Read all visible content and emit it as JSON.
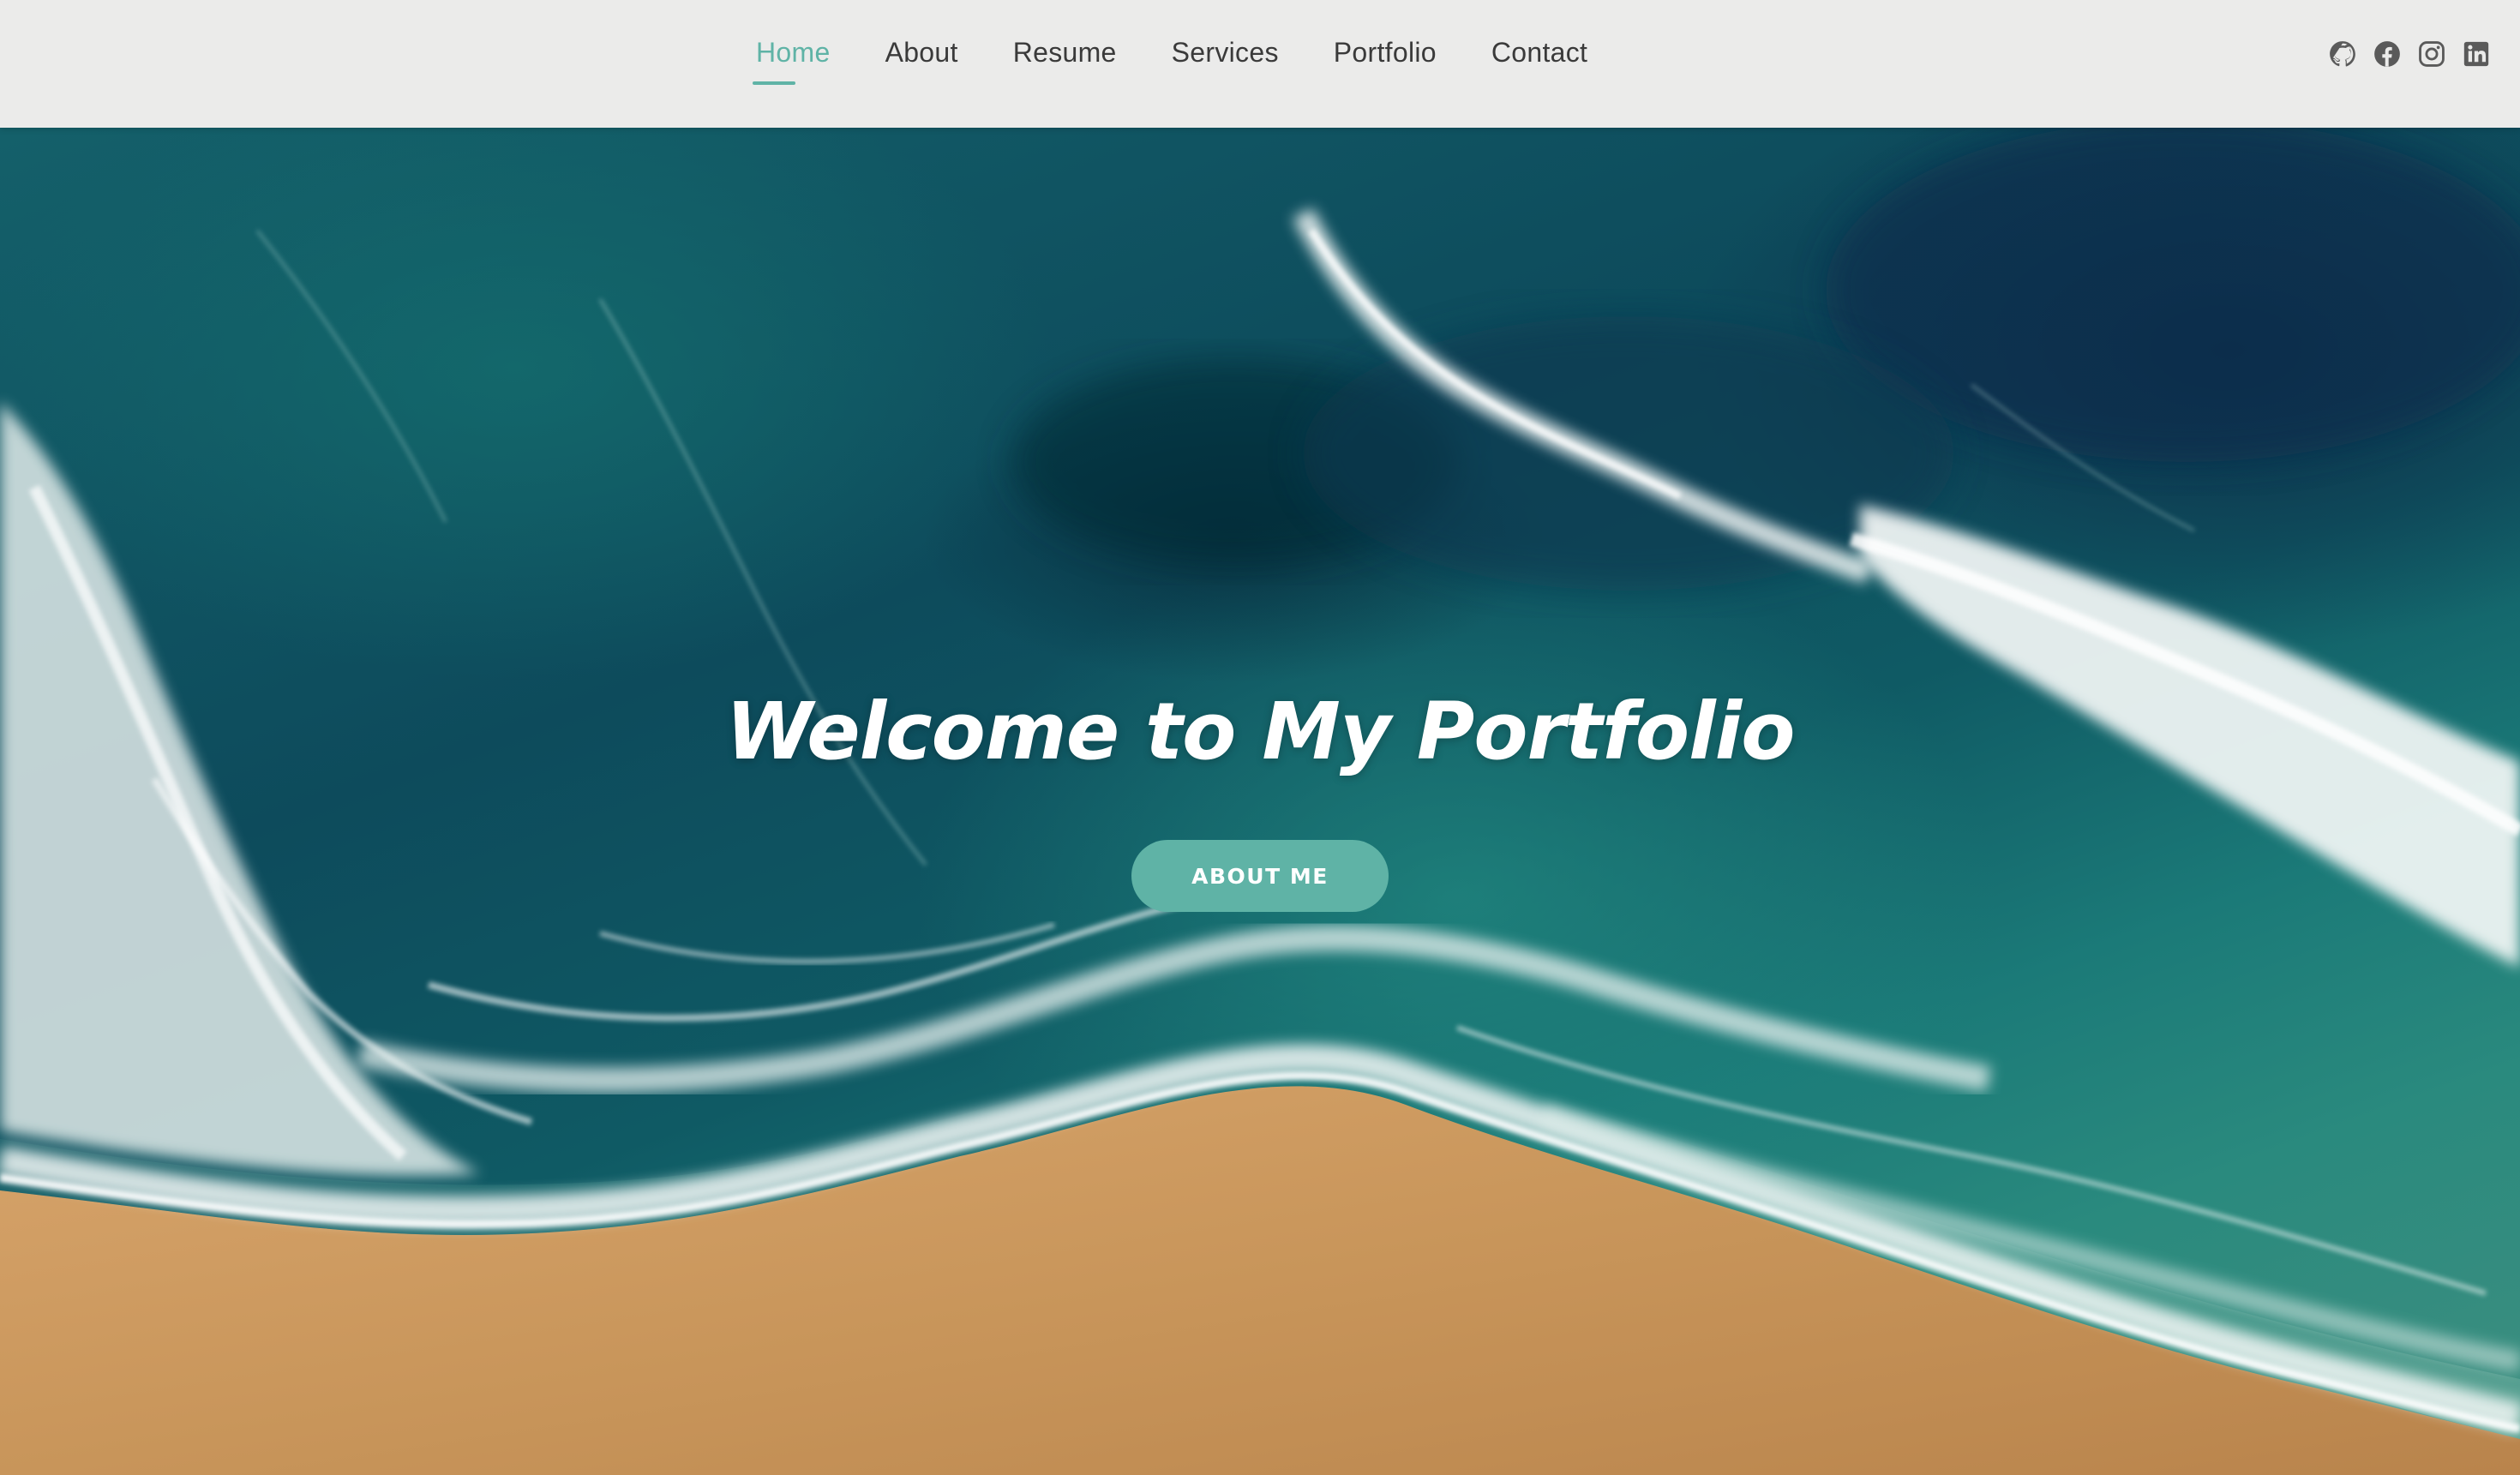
{
  "nav": {
    "items": [
      {
        "label": "Home",
        "active": true
      },
      {
        "label": "About",
        "active": false
      },
      {
        "label": "Resume",
        "active": false
      },
      {
        "label": "Services",
        "active": false
      },
      {
        "label": "Portfolio",
        "active": false
      },
      {
        "label": "Contact",
        "active": false
      }
    ]
  },
  "socials": [
    "github-icon",
    "facebook-icon",
    "instagram-icon",
    "linkedin-icon"
  ],
  "hero": {
    "title": "Welcome to My Portfolio",
    "button_label": "ABOUT ME"
  },
  "colors": {
    "accent": "#5fb3a6",
    "header_bg": "#ebebea",
    "nav_text": "#3a3a3a",
    "icon": "#5a5a5a",
    "sand": "#c8955a",
    "ocean": "#0f5a64"
  }
}
